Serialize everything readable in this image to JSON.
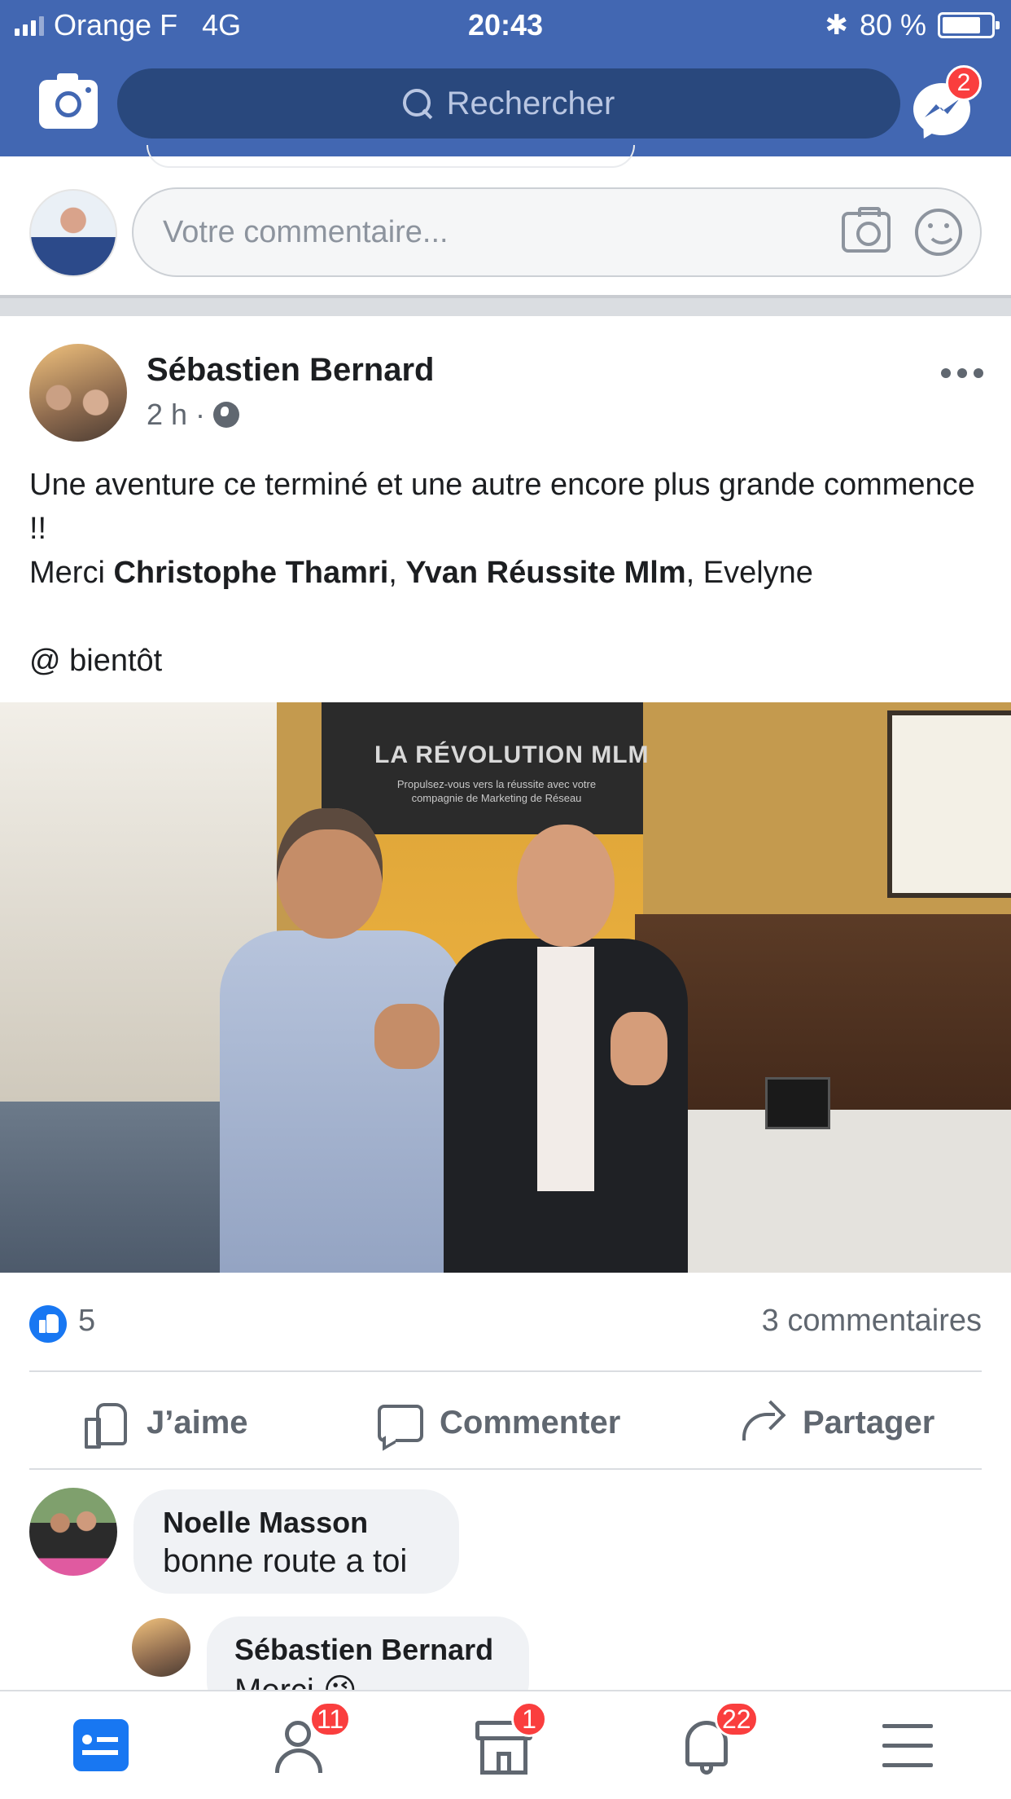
{
  "status_bar": {
    "carrier": "Orange F",
    "network": "4G",
    "time": "20:43",
    "bluetooth_icon": "bluetooth-icon",
    "battery": "80 %",
    "battery_level": 0.8
  },
  "header": {
    "search_placeholder": "Rechercher",
    "messenger_badge": "2"
  },
  "composer": {
    "placeholder": "Votre commentaire..."
  },
  "post": {
    "author": "Sébastien Bernard",
    "time": "2 h",
    "separator": "·",
    "text_line1": "Une aventure ce terminé et une autre encore plus grande commence !!",
    "text_merci": "Merci ",
    "mention1": "Christophe Thamri",
    "comma": ", ",
    "mention2": "Yvan Réussite Mlm",
    "text_tail": ", Evelyne",
    "text_closing": "@ bientôt",
    "photo": {
      "banner_title": "LA RÉVOLUTION MLM",
      "banner_subtitle": "Propulsez-vous vers la réussite avec votre compagnie de Marketing de Réseau"
    },
    "like_count": "5",
    "comment_count": "3 commentaires",
    "actions": {
      "like": "J’aime",
      "comment": "Commenter",
      "share": "Partager"
    }
  },
  "comments": [
    {
      "author": "Noelle Masson",
      "text": "bonne route a toi"
    },
    {
      "author": "Sébastien Bernard",
      "text": "Merci 😉"
    }
  ],
  "tabbar": {
    "friends_badge": "11",
    "marketplace_badge": "1",
    "notifications_badge": "22"
  },
  "colors": {
    "brand": "#4267b2",
    "search_bg": "#29487d",
    "badge": "#fa3e3e",
    "active_tab": "#1877f2"
  }
}
